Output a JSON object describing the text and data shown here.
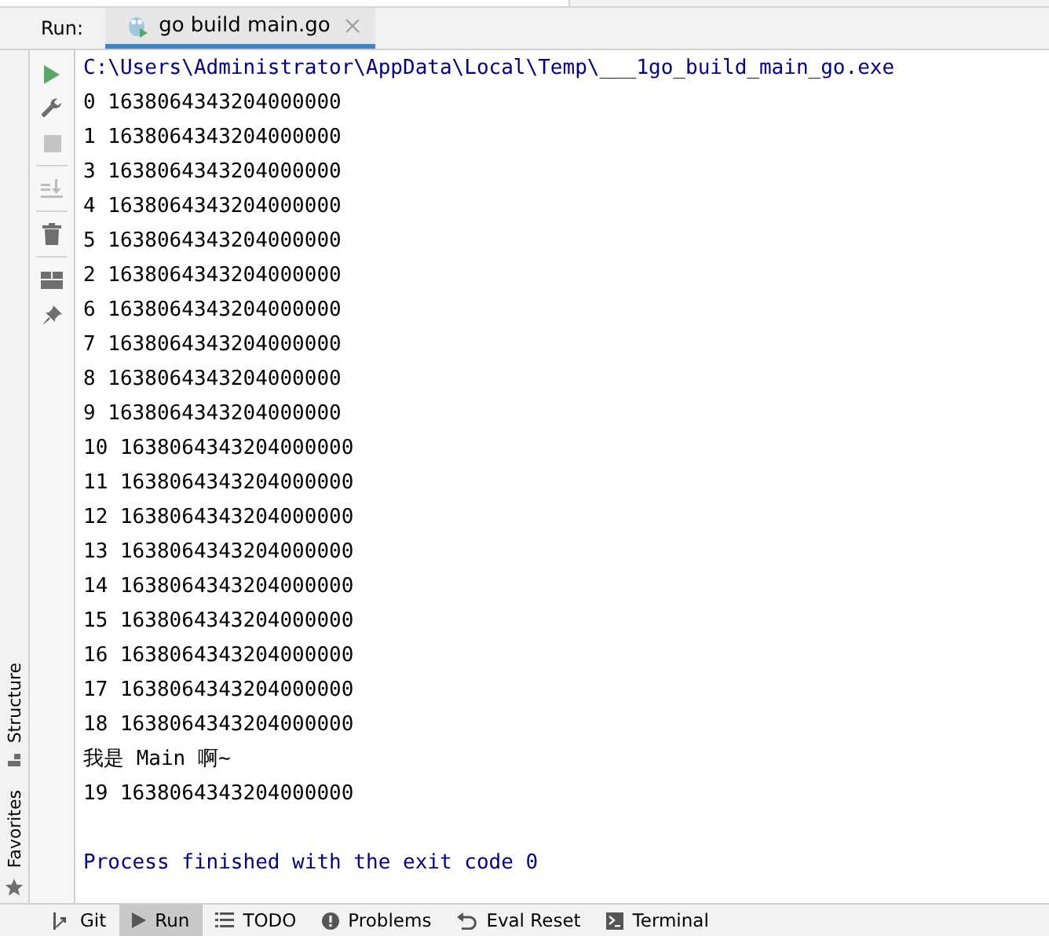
{
  "run_panel": {
    "label": "Run:",
    "tabs": [
      {
        "label": "go build main.go",
        "selected": true
      }
    ]
  },
  "toolbar": [
    {
      "kind": "run",
      "disabled": false
    },
    {
      "kind": "wrench",
      "disabled": false
    },
    {
      "kind": "stop",
      "disabled": true
    },
    {
      "kind": "scroll",
      "disabled": true
    },
    {
      "kind": "trash",
      "disabled": false
    },
    {
      "kind": "layout",
      "disabled": false
    },
    {
      "kind": "pin",
      "disabled": false
    }
  ],
  "side_tabs": [
    {
      "label": "Structure",
      "kind": "structure"
    },
    {
      "label": "Favorites",
      "kind": "favorites"
    }
  ],
  "console": [
    {
      "kind": "command",
      "text": "C:\\Users\\Administrator\\AppData\\Local\\Temp\\___1go_build_main_go.exe"
    },
    {
      "kind": "output",
      "text": "0 1638064343204000000"
    },
    {
      "kind": "output",
      "text": "1 1638064343204000000"
    },
    {
      "kind": "output",
      "text": "3 1638064343204000000"
    },
    {
      "kind": "output",
      "text": "4 1638064343204000000"
    },
    {
      "kind": "output",
      "text": "5 1638064343204000000"
    },
    {
      "kind": "output",
      "text": "2 1638064343204000000"
    },
    {
      "kind": "output",
      "text": "6 1638064343204000000"
    },
    {
      "kind": "output",
      "text": "7 1638064343204000000"
    },
    {
      "kind": "output",
      "text": "8 1638064343204000000"
    },
    {
      "kind": "output",
      "text": "9 1638064343204000000"
    },
    {
      "kind": "output",
      "text": "10 1638064343204000000"
    },
    {
      "kind": "output",
      "text": "11 1638064343204000000"
    },
    {
      "kind": "output",
      "text": "12 1638064343204000000"
    },
    {
      "kind": "output",
      "text": "13 1638064343204000000"
    },
    {
      "kind": "output",
      "text": "14 1638064343204000000"
    },
    {
      "kind": "output",
      "text": "15 1638064343204000000"
    },
    {
      "kind": "output",
      "text": "16 1638064343204000000"
    },
    {
      "kind": "output",
      "text": "17 1638064343204000000"
    },
    {
      "kind": "output",
      "text": "18 1638064343204000000"
    },
    {
      "kind": "output",
      "text": "我是 Main 啊~"
    },
    {
      "kind": "output",
      "text": "19 1638064343204000000"
    },
    {
      "kind": "exit",
      "text": "Process finished with the exit code 0"
    }
  ],
  "bottom_tabs": [
    {
      "kind": "git",
      "label": "Git",
      "selected": false
    },
    {
      "kind": "run",
      "label": "Run",
      "selected": true
    },
    {
      "kind": "todo",
      "label": "TODO",
      "selected": false
    },
    {
      "kind": "problems",
      "label": "Problems",
      "selected": false
    },
    {
      "kind": "reset",
      "label": "Eval Reset",
      "selected": false
    },
    {
      "kind": "terminal",
      "label": "Terminal",
      "selected": false
    }
  ]
}
